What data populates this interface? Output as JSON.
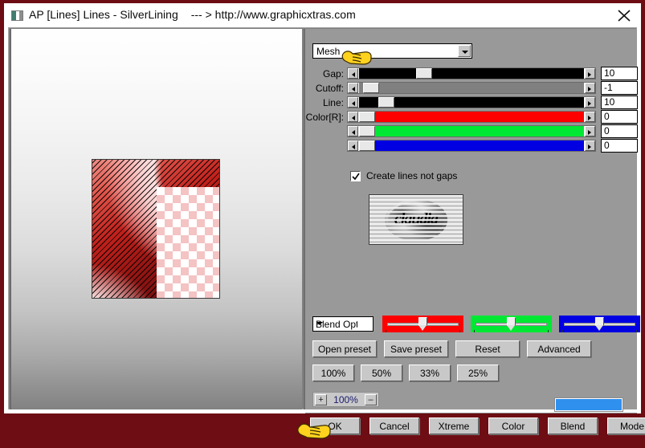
{
  "window": {
    "title": "AP [Lines]  Lines - SilverLining",
    "url": "--- > http://www.graphicxtras.com",
    "close_label": "✕",
    "icon": "image-thumbnail-icon"
  },
  "preset": {
    "selected": "Mesh",
    "options": [
      "Mesh"
    ]
  },
  "sliders": [
    {
      "label": "Gap:",
      "value": "10",
      "thumb_pct": 27,
      "track": "#000000"
    },
    {
      "label": "Cutoff:",
      "value": "-1",
      "thumb_pct": 2,
      "track": "#808080"
    },
    {
      "label": "Line:",
      "value": "10",
      "thumb_pct": 9,
      "track": "#000000"
    },
    {
      "label": "Color[R]:",
      "value": "0",
      "thumb_pct": 0,
      "track": "#ff0000"
    },
    {
      "label": "",
      "value": "0",
      "thumb_pct": 0,
      "track": "#00e833"
    },
    {
      "label": "",
      "value": "0",
      "thumb_pct": 0,
      "track": "#0000e2"
    }
  ],
  "checkbox": {
    "label": "Create lines not gaps",
    "checked": true
  },
  "thumbnail": {
    "wordmark": "claudia"
  },
  "blend": {
    "combo_value": "Blend Opti",
    "sliders": [
      {
        "name": "red-blend",
        "color": "#ff0000",
        "thumb_pct": 50
      },
      {
        "name": "green-blend",
        "color": "#00e833",
        "thumb_pct": 50
      },
      {
        "name": "blue-blend",
        "color": "#0000e2",
        "thumb_pct": 50
      }
    ]
  },
  "preset_buttons": [
    "Open preset",
    "Save preset",
    "Reset",
    "Advanced"
  ],
  "zoom_buttons": [
    "100%",
    "50%",
    "33%",
    "25%"
  ],
  "stepper": {
    "plus": "+",
    "value": "100%",
    "minus": "–"
  },
  "swatch": {
    "color": "#2f90ee"
  },
  "action_buttons": [
    "OK",
    "Cancel",
    "Xtreme",
    "Color",
    "Blend",
    "Mode"
  ]
}
